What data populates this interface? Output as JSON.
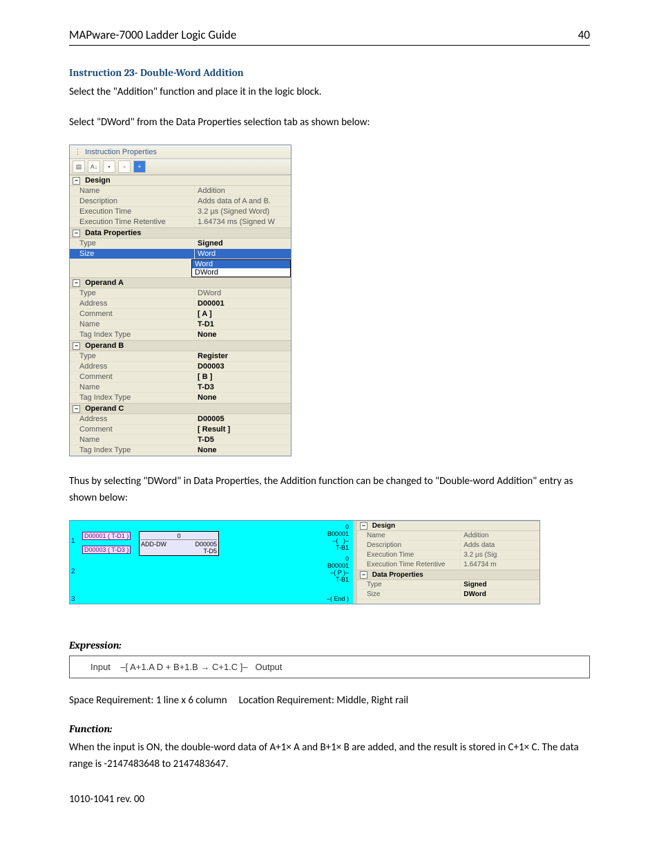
{
  "header": {
    "title": "MAPware-7000 Ladder Logic Guide",
    "page": "40"
  },
  "instruction": {
    "number": "Instruction 23-",
    "dw": "Double-Word",
    "add": "Addition"
  },
  "paras": {
    "p1": "Select the \"Addition\" function and place it in the logic block.",
    "p2": "Select \"DWord\" from the Data Properties selection tab as shown below:",
    "p3": "Thus by selecting \"DWord\" in Data Properties, the Addition function can be changed to \"Double-word Addition\" entry as shown below:"
  },
  "panel": {
    "title": "Instruction Properties",
    "sections": {
      "design": {
        "title": "Design",
        "rows": [
          {
            "k": "Name",
            "v": "Addition",
            "bold": false
          },
          {
            "k": "Description",
            "v": "Adds data of A and B.",
            "bold": false
          },
          {
            "k": "Execution Time",
            "v": "3.2 µs (Signed Word)",
            "bold": false
          },
          {
            "k": "Execution Time Retentive",
            "v": "1.64734 ms (Signed W",
            "bold": false
          }
        ]
      },
      "dataprops": {
        "title": "Data Properties",
        "type": {
          "k": "Type",
          "v": "Signed"
        },
        "size": {
          "k": "Size",
          "v": "Word",
          "opt1": "Word",
          "opt2": "DWord"
        }
      },
      "opA": {
        "title": "Operand A",
        "rows": [
          {
            "k": "Type",
            "v": "DWord",
            "bold": false
          },
          {
            "k": "Address",
            "v": "D00001",
            "bold": true
          },
          {
            "k": "Comment",
            "v": "[ A ]",
            "bold": true
          },
          {
            "k": "Name",
            "v": "T-D1",
            "bold": true
          },
          {
            "k": "Tag Index Type",
            "v": "None",
            "bold": true
          }
        ]
      },
      "opB": {
        "title": "Operand B",
        "rows": [
          {
            "k": "Type",
            "v": "Register",
            "bold": true
          },
          {
            "k": "Address",
            "v": "D00003",
            "bold": true
          },
          {
            "k": "Comment",
            "v": "[ B ]",
            "bold": true
          },
          {
            "k": "Name",
            "v": "T-D3",
            "bold": true
          },
          {
            "k": "Tag Index Type",
            "v": "None",
            "bold": true
          }
        ]
      },
      "opC": {
        "title": "Operand C",
        "rows": [
          {
            "k": "Address",
            "v": "D00005",
            "bold": true
          },
          {
            "k": "Comment",
            "v": "[ Result ]",
            "bold": true
          },
          {
            "k": "Name",
            "v": "T-D5",
            "bold": true
          },
          {
            "k": "Tag Index Type",
            "v": "None",
            "bold": true
          }
        ]
      }
    }
  },
  "ladder": {
    "row1": "1",
    "row2": "2",
    "row3": "3",
    "boxA": "D00001 ( T-D1 )",
    "boxB": "D00003 ( T-D3 )",
    "inst": "ADD-DW",
    "inst_top": "0",
    "res": "D00005",
    "res2": "T-D5",
    "coil1a": "0",
    "coil1b": "B00001",
    "coil1c": "T-B1",
    "coil2a": "0",
    "coil2b": "B00001",
    "coil2c": "P",
    "coil2d": "T-B1",
    "end": "End"
  },
  "side_panel": {
    "design_title": "Design",
    "rows_design": [
      {
        "k": "Name",
        "v": "Addition"
      },
      {
        "k": "Description",
        "v": "Adds data"
      },
      {
        "k": "Execution Time",
        "v": "3.2 µs (Sig"
      },
      {
        "k": "Execution Time Retentive",
        "v": "1.64734 m"
      }
    ],
    "dp_title": "Data Properties",
    "rows_dp": [
      {
        "k": "Type",
        "v": "Signed"
      },
      {
        "k": "Size",
        "v": "DWord"
      }
    ]
  },
  "expression": {
    "title": "Expression:",
    "input": "Input",
    "expr": "–[ A+1.A   D   +     B+1.B  →  C+1.C ]–",
    "output": "Output"
  },
  "requirements": "Space Requirement: 1 line x 6 column     Location Requirement: Middle, Right rail",
  "function": {
    "title": "Function:",
    "body": "When the input is ON, the double-word data of A+1× A and B+1× B are added, and the result is stored in C+1× C. The data range is -2147483648 to 2147483647."
  },
  "footer": "1010-1041 rev. 00"
}
